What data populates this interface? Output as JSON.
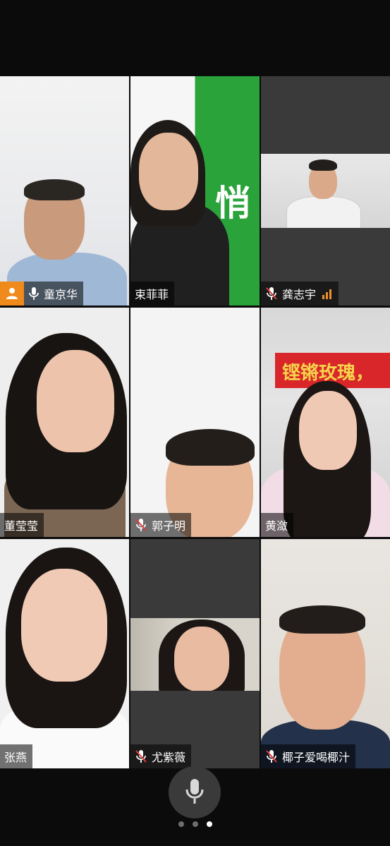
{
  "participants": [
    {
      "name": "童京华",
      "mic": "on",
      "host": true
    },
    {
      "name": "束菲菲",
      "mic": "none"
    },
    {
      "name": "龚志宇",
      "mic": "off",
      "signal": true
    },
    {
      "name": "董莹莹",
      "mic": "none"
    },
    {
      "name": "郭子明",
      "mic": "off"
    },
    {
      "name": "黄潋",
      "mic": "none"
    },
    {
      "name": "张燕",
      "mic": "none"
    },
    {
      "name": "尤紫薇",
      "mic": "off"
    },
    {
      "name": "椰子爱喝椰汁",
      "mic": "off"
    }
  ],
  "backgrounds": {
    "tile3_banner": "铿锵玫瑰，",
    "tile2_sign": "悄"
  },
  "colors": {
    "host_badge": "#f08a1a",
    "muted_icon": "#ffffff",
    "signal": "#f0902a",
    "banner_red": "#d8262a"
  },
  "controls": {
    "mic_icon": "microphone-icon",
    "pager": {
      "total": 3,
      "active": 3
    }
  }
}
